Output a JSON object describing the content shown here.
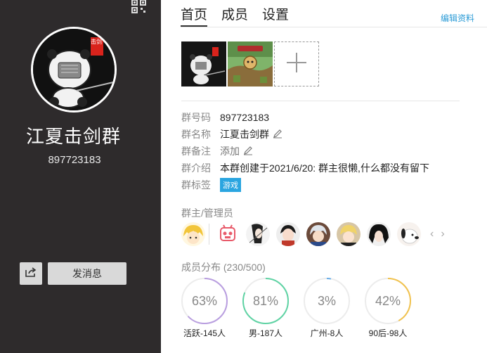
{
  "left": {
    "group_name": "江夏击剑群",
    "group_id": "897723183",
    "send_message_label": "发消息",
    "avatar_stamp": "击剑"
  },
  "tabs": [
    "首页",
    "成员",
    "设置"
  ],
  "active_tab": 0,
  "edit_link": "编辑资料",
  "info": {
    "number_label": "群号码",
    "number_value": "897723183",
    "name_label": "群名称",
    "name_value": "江夏击剑群",
    "remark_label": "群备注",
    "remark_value": "添加",
    "intro_label": "群介绍",
    "intro_value": "本群创建于2021/6/20:  群主很懒,什么都没有留下",
    "tags_label": "群标签",
    "tag": "游戏"
  },
  "admins_title": "群主/管理员",
  "distribution": {
    "title": "成员分布 (230/500)",
    "items": [
      {
        "percent": "63%",
        "value": 0.63,
        "label": "活跃-145人",
        "color": "#b99ee0"
      },
      {
        "percent": "81%",
        "value": 0.81,
        "label": "男-187人",
        "color": "#5fd3a4"
      },
      {
        "percent": "3%",
        "value": 0.03,
        "label": "广州-8人",
        "color": "#6aaee8"
      },
      {
        "percent": "42%",
        "value": 0.42,
        "label": "90后-98人",
        "color": "#f1c24e"
      }
    ]
  },
  "colors": {
    "sidebar_bg": "#2e2b2c",
    "link_blue": "#2b9bd6",
    "tag_bg": "#2aa5e0"
  },
  "icons": {
    "qr": "qr-code-icon",
    "share": "share-icon",
    "pencil": "pencil-icon",
    "add": "plus-icon",
    "prev": "chevron-left-icon",
    "next": "chevron-right-icon"
  }
}
